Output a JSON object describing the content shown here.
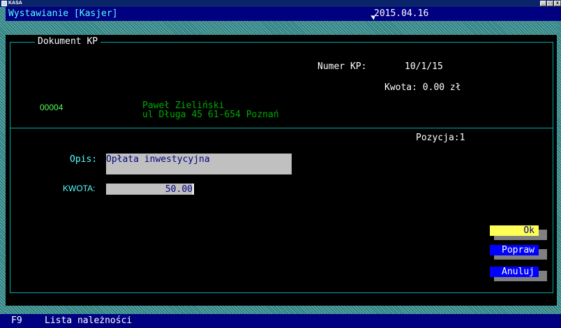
{
  "window": {
    "title": "KASA",
    "controls": {
      "minimize": "_",
      "maximize": "□",
      "close": "x"
    }
  },
  "header": {
    "title": "Wystawianie [Kasjer]",
    "date": "2015.04.16"
  },
  "document": {
    "frame_title": "Dokument KP",
    "numer_label": "Numer KP:",
    "numer_value": "10/1/15",
    "kwota_total": "Kwota: 0.00 zł",
    "client_code": "00004",
    "client_name": "Paweł Zieliński",
    "client_address": "ul Długa 45 61-654 Poznań",
    "pozycja": "Pozycja:1"
  },
  "form": {
    "opis_label": "Opis:",
    "opis_value": "Opłata inwestycyjna",
    "kwota_label": "KWOTA:",
    "kwota_value": "50.00"
  },
  "buttons": {
    "ok": "Ok",
    "popraw": "Popraw",
    "anuluj": "Anuluj"
  },
  "statusbar": {
    "key": "F9",
    "description": "Lista należności"
  },
  "colors": {
    "title_bar": "#0a246a",
    "header_bg": "#000080",
    "header_text": "#55ffff",
    "frame": "#00aaaa",
    "ok_button": "#ffff55",
    "blue_button": "#0000ff",
    "field_bg": "#c0c0c0",
    "field_text": "#000080",
    "client_text": "#00aa00"
  },
  "icons": {
    "app": "kasa-app-icon",
    "cursor": "mouse-pointer-icon"
  }
}
